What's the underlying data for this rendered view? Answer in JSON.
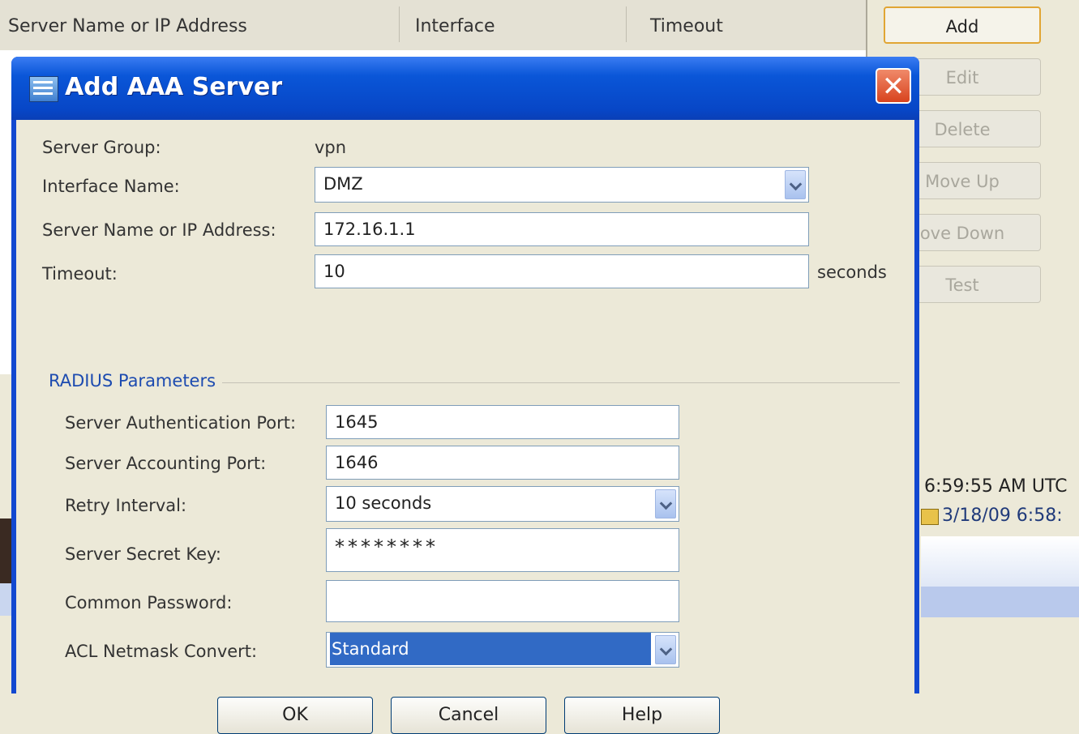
{
  "background": {
    "table_columns": [
      "Server Name or IP Address",
      "Interface",
      "Timeout"
    ],
    "side_buttons": [
      "Add",
      "Edit",
      "Delete",
      "Move Up",
      "ove Down",
      "Test"
    ],
    "log_rows": [
      "6:59:55 AM UTC",
      "3/18/09 6:58:"
    ]
  },
  "dialog": {
    "title": "Add AAA Server",
    "close_label": "✕",
    "server_group_label": "Server Group:",
    "server_group_value": "vpn",
    "interface_label": "Interface Name:",
    "interface_value": "DMZ",
    "server_label": "Server Name or IP Address:",
    "server_value": "172.16.1.1",
    "timeout_label": "Timeout:",
    "timeout_value": "10",
    "timeout_unit": "seconds",
    "radius_section": "RADIUS Parameters",
    "auth_port_label": "Server Authentication Port:",
    "auth_port_value": "1645",
    "acct_port_label": "Server Accounting Port:",
    "acct_port_value": "1646",
    "retry_label": "Retry Interval:",
    "retry_value": "10 seconds",
    "secret_label": "Server Secret Key:",
    "secret_value": "********",
    "common_pw_label": "Common Password:",
    "common_pw_value": "",
    "acl_label": "ACL Netmask Convert:",
    "acl_value": "Standard",
    "ok_label": "OK",
    "cancel_label": "Cancel",
    "help_label": "Help"
  },
  "colors": {
    "titlebar": "#0a56d8",
    "accent_focus": "#e1a534",
    "selection": "#316ac5",
    "section_text": "#1d4bb0"
  }
}
